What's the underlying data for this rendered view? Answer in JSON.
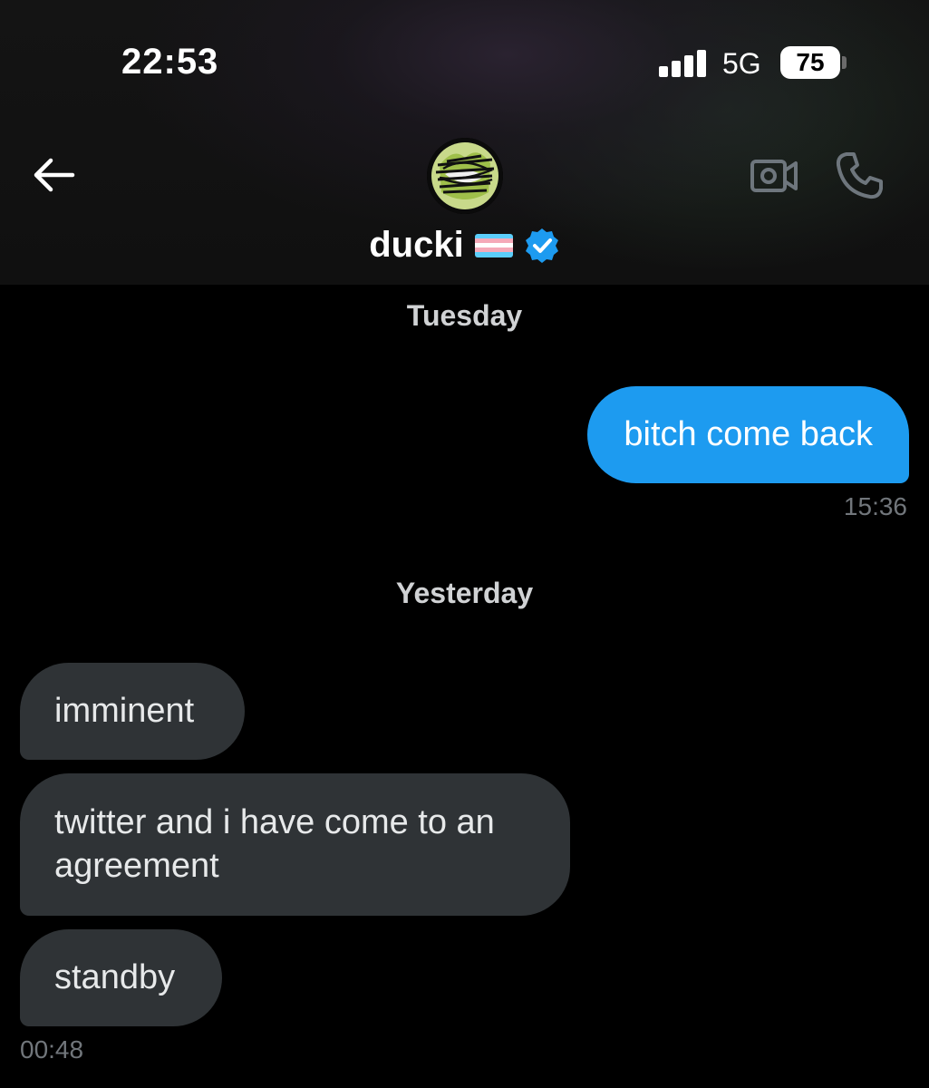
{
  "status_bar": {
    "time": "22:53",
    "network": "5G",
    "battery": "75"
  },
  "header": {
    "contact_name": "ducki",
    "flag_icon": "transgender-flag",
    "verified_icon": "verified-badge",
    "back_icon": "arrow-left-icon",
    "video_icon": "video-call-icon",
    "phone_icon": "phone-call-icon"
  },
  "conversation": {
    "sections": [
      {
        "day": "Tuesday"
      },
      {
        "day": "Yesterday"
      }
    ],
    "outgoing": {
      "text": "bitch come back",
      "time": "15:36"
    },
    "incoming": [
      {
        "text": "imminent"
      },
      {
        "text": "twitter and i have come to an agreement"
      },
      {
        "text": "standby"
      }
    ],
    "incoming_time": "00:48"
  },
  "colors": {
    "accent": "#1d9bf0",
    "incoming_bubble": "#2f3336",
    "background": "#000000"
  }
}
